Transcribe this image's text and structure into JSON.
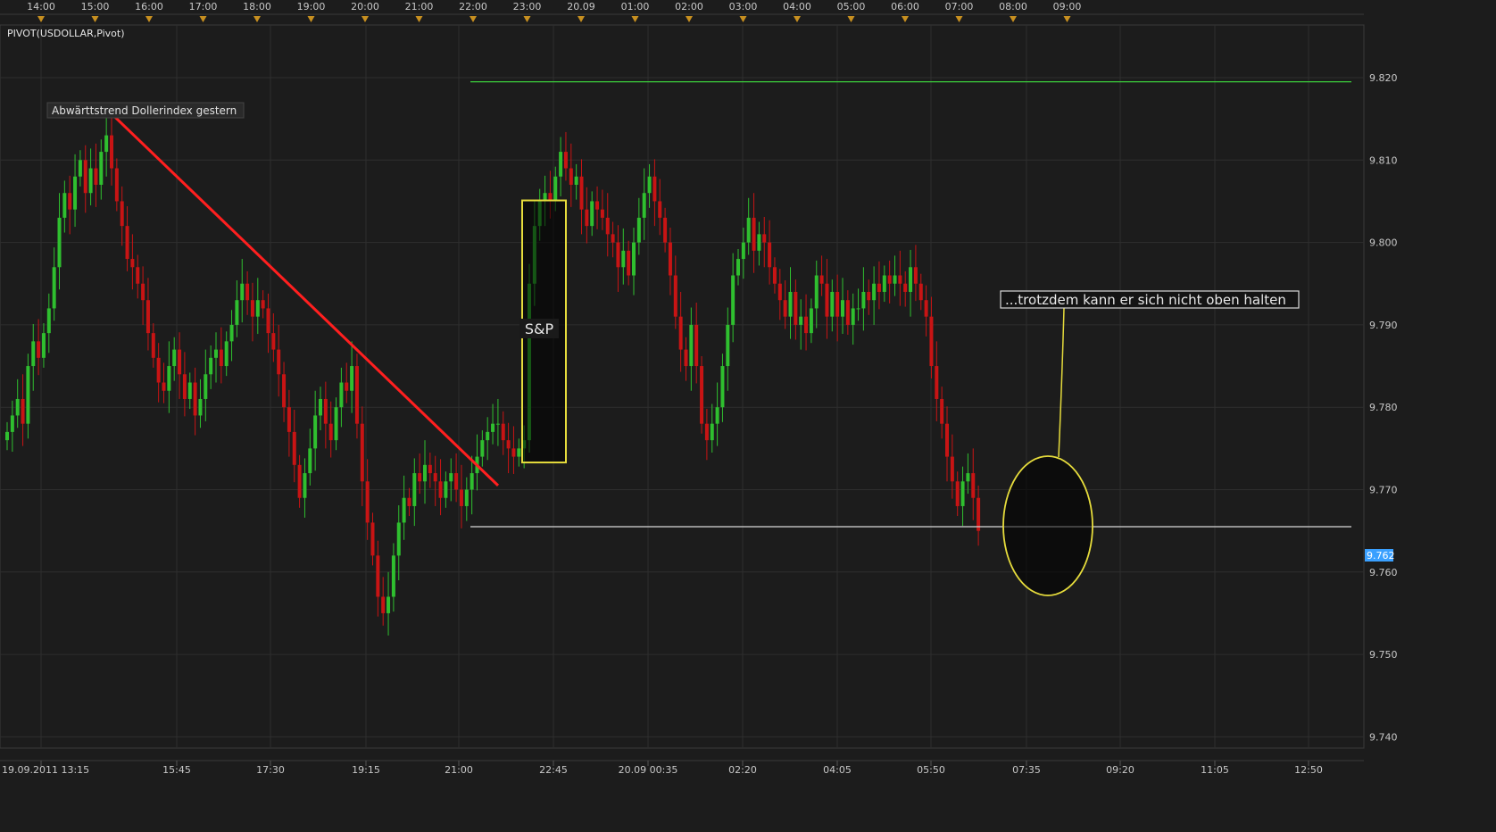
{
  "indicator_label": "PIVOT(USDOLLAR,Pivot)",
  "colors": {
    "background": "#1c1c1c",
    "grid": "#2e2e2e",
    "up": "#2fbf2f",
    "down": "#c81414",
    "trendline": "#ff1f1f",
    "highlight": "#e6dc3c",
    "resistance": "#3ccf3c",
    "support": "#d8d8d8",
    "price_badge": "#3aa0ff"
  },
  "top_time_labels": [
    "14:00",
    "15:00",
    "16:00",
    "17:00",
    "18:00",
    "19:00",
    "20:00",
    "21:00",
    "22:00",
    "23:00",
    "20.09",
    "01:00",
    "02:00",
    "03:00",
    "04:00",
    "05:00",
    "06:00",
    "07:00",
    "08:00",
    "09:00"
  ],
  "bottom_time_labels": [
    "19.09.2011 13:15",
    "15:45",
    "17:30",
    "19:15",
    "21:00",
    "22:45",
    "20.09 00:35",
    "02:20",
    "04:05",
    "05:50",
    "07:35",
    "09:20",
    "11:05",
    "12:50"
  ],
  "current_price": "9.762",
  "annotations": {
    "trend_label": "Abwärttstrend Dollerindex gestern",
    "sp_label": "S&P",
    "note_label": "...trotzdem kann er sich nicht oben halten"
  },
  "chart_data": {
    "type": "candlestick",
    "title": "PIVOT(USDOLLAR,Pivot)",
    "interval": "5 minutes",
    "x_range": [
      "19.09.2011 13:15",
      "20.09.2011 14:00"
    ],
    "ylim": [
      9.738,
      9.831
    ],
    "y_ticks": [
      9.82,
      9.81,
      9.8,
      9.79,
      9.78,
      9.77,
      9.76,
      9.75,
      9.74
    ],
    "y_tick_labels": [
      "9.820",
      "9.810",
      "9.800",
      "9.790",
      "9.780",
      "9.770",
      "9.760",
      "9.750",
      "9.740"
    ],
    "grid": true,
    "closes": [
      9.777,
      9.779,
      9.781,
      9.778,
      9.785,
      9.788,
      9.786,
      9.789,
      9.792,
      9.797,
      9.803,
      9.806,
      9.804,
      9.808,
      9.81,
      9.806,
      9.809,
      9.807,
      9.811,
      9.813,
      9.809,
      9.805,
      9.802,
      9.798,
      9.797,
      9.795,
      9.793,
      9.789,
      9.786,
      9.783,
      9.782,
      9.785,
      9.787,
      9.784,
      9.781,
      9.783,
      9.779,
      9.781,
      9.784,
      9.786,
      9.787,
      9.785,
      9.788,
      9.79,
      9.793,
      9.795,
      9.793,
      9.791,
      9.793,
      9.792,
      9.789,
      9.787,
      9.784,
      9.78,
      9.777,
      9.773,
      9.769,
      9.772,
      9.775,
      9.779,
      9.781,
      9.778,
      9.776,
      9.78,
      9.783,
      9.782,
      9.785,
      9.778,
      9.771,
      9.766,
      9.762,
      9.757,
      9.755,
      9.757,
      9.762,
      9.766,
      9.769,
      9.768,
      9.772,
      9.771,
      9.773,
      9.772,
      9.771,
      9.769,
      9.771,
      9.772,
      9.77,
      9.768,
      9.77,
      9.772,
      9.774,
      9.776,
      9.777,
      9.778,
      9.778,
      9.776,
      9.775,
      9.774,
      9.775,
      9.776,
      9.795,
      9.802,
      9.805,
      9.806,
      9.805,
      9.808,
      9.811,
      9.809,
      9.807,
      9.808,
      9.804,
      9.802,
      9.805,
      9.804,
      9.803,
      9.801,
      9.8,
      9.797,
      9.799,
      9.796,
      9.8,
      9.803,
      9.806,
      9.808,
      9.805,
      9.803,
      9.8,
      9.796,
      9.791,
      9.787,
      9.785,
      9.79,
      9.785,
      9.778,
      9.776,
      9.778,
      9.78,
      9.785,
      9.79,
      9.796,
      9.798,
      9.8,
      9.803,
      9.799,
      9.801,
      9.8,
      9.797,
      9.795,
      9.793,
      9.791,
      9.794,
      9.79,
      9.791,
      9.789,
      9.792,
      9.796,
      9.795,
      9.791,
      9.794,
      9.791,
      9.793,
      9.79,
      9.792,
      9.792,
      9.794,
      9.793,
      9.795,
      9.794,
      9.796,
      9.795,
      9.796,
      9.795,
      9.794,
      9.797,
      9.795,
      9.793,
      9.791,
      9.785,
      9.781,
      9.778,
      9.774,
      9.771,
      9.768,
      9.771,
      9.772,
      9.769,
      9.765
    ],
    "annotations": [
      {
        "type": "trendline",
        "label": "Abwärttstrend Dollerindex gestern",
        "from": {
          "time": "19.09 15:45",
          "value": 9.8152
        },
        "to": {
          "time": "19.09 22:30",
          "value": 9.7705
        }
      },
      {
        "type": "highlight_box",
        "label": "S&P",
        "from_time": "19.09 22:55",
        "to_time": "19.09 23:50",
        "value_range": [
          9.7733,
          9.8051
        ]
      },
      {
        "type": "hline",
        "color": "green",
        "value": 9.8195,
        "from_time": "19.09 22:15"
      },
      {
        "type": "hline",
        "color": "white",
        "value": 9.7655,
        "from_time": "19.09 22:15"
      },
      {
        "type": "ellipse",
        "label": "...trotzdem kann er sich nicht oben halten",
        "center_time": "20.09 08:35",
        "center_value": 9.7655
      }
    ]
  }
}
